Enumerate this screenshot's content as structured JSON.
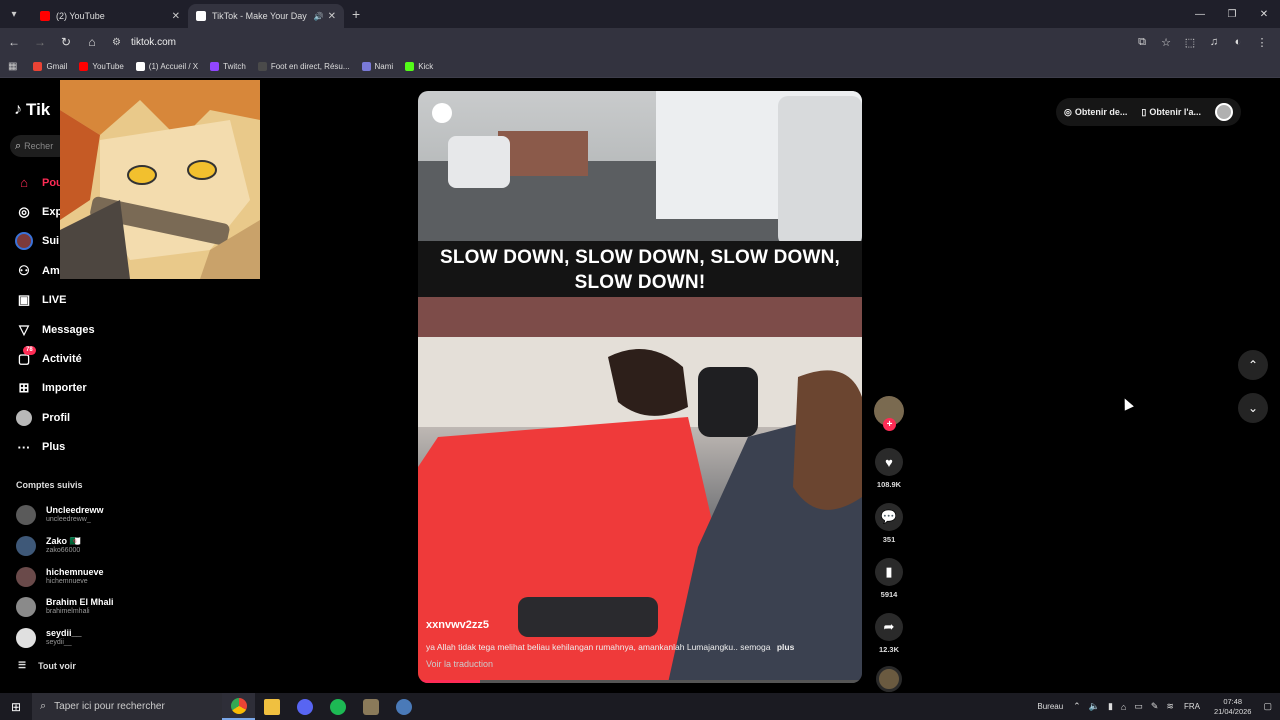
{
  "browser": {
    "tabs": [
      {
        "title": "(2) YouTube",
        "favicon_color": "#ff0000",
        "active": false
      },
      {
        "title": "TikTok - Make Your Day",
        "favicon_color": "#ffffff",
        "active": true
      }
    ],
    "new_tab_icon": "+",
    "window_controls": {
      "minimize": "—",
      "restore": "❐",
      "close": "✕"
    },
    "url": "tiktok.com",
    "bookmarks": [
      {
        "label": "Gmail",
        "color": "#ea4335"
      },
      {
        "label": "YouTube",
        "color": "#ff0000"
      },
      {
        "label": "(1) Accueil / X",
        "color": "#ffffff"
      },
      {
        "label": "Twitch",
        "color": "#9146ff"
      },
      {
        "label": "Foot en direct, Résu...",
        "color": "#4a4a4a"
      },
      {
        "label": "Nami",
        "color": "#7a7ad8"
      },
      {
        "label": "Kick",
        "color": "#53fc18"
      }
    ]
  },
  "tiktok": {
    "logo_text": "Tik",
    "search_placeholder": "Recher",
    "nav": [
      {
        "label": "Pour",
        "icon": "home-icon",
        "glyph": "⌂",
        "active": true
      },
      {
        "label": "Exp",
        "icon": "compass-icon",
        "glyph": "◎",
        "active": false
      },
      {
        "label": "Sui",
        "icon": "following-avatar-icon",
        "glyph": "",
        "active": false
      },
      {
        "label": "Am",
        "icon": "friends-icon",
        "glyph": "👥",
        "active": false
      },
      {
        "label": "LIVE",
        "icon": "live-icon",
        "glyph": "▣",
        "active": false
      },
      {
        "label": "Messages",
        "icon": "messages-icon",
        "glyph": "▽",
        "active": false
      },
      {
        "label": "Activité",
        "icon": "activity-icon",
        "glyph": "▢",
        "active": false,
        "badge": "78"
      },
      {
        "label": "Importer",
        "icon": "upload-icon",
        "glyph": "⊞",
        "active": false
      },
      {
        "label": "Profil",
        "icon": "profile-icon",
        "glyph": "●",
        "active": false
      },
      {
        "label": "Plus",
        "icon": "more-icon",
        "glyph": "···",
        "active": false
      }
    ],
    "followed_title": "Comptes suivis",
    "followed": [
      {
        "name": "Uncleedreww",
        "handle": "uncleedreww_",
        "color": "#5a5a5a"
      },
      {
        "name": "Zako 🇩🇿",
        "handle": "zako66000",
        "color": "#3e5878"
      },
      {
        "name": "hichemnueve",
        "handle": "hichemnueve",
        "color": "#6a4a4a"
      },
      {
        "name": "Brahim El Mhali",
        "handle": "brahimelmhali",
        "color": "#8a8a8a"
      },
      {
        "name": "seydii__",
        "handle": "seydii__",
        "color": "#e0e0e0"
      }
    ],
    "see_all": "Tout voir",
    "video": {
      "caption": "SLOW DOWN, SLOW DOWN, SLOW DOWN, SLOW DOWN!",
      "username": "xxnvwv2zz5",
      "description": "ya Allah tidak tega melihat beliau kehilangan rumahnya, amankanlah Lumajangku.. semoga",
      "more_label": "plus",
      "translate": "Voir la traduction",
      "progress": 0.14
    },
    "actions": {
      "likes": "108.9K",
      "comments": "351",
      "saves": "5914",
      "shares": "12.3K"
    },
    "top_right": {
      "btn1": "Obtenir de...",
      "btn2": "Obtenir l'a..."
    }
  },
  "taskbar": {
    "search_placeholder": "Taper ici pour rechercher",
    "apps": [
      {
        "name": "chrome",
        "color": "#e8b43a",
        "active": true
      },
      {
        "name": "explorer",
        "color": "#f0c040",
        "active": false
      },
      {
        "name": "discord",
        "color": "#5865f2",
        "active": false
      },
      {
        "name": "spotify",
        "color": "#1db954",
        "active": false
      },
      {
        "name": "game",
        "color": "#8a7a5a",
        "active": false
      },
      {
        "name": "steam",
        "color": "#4a7ab8",
        "active": false
      }
    ],
    "tray_label": "Bureau",
    "language": "FRA",
    "time": "07:48",
    "date": "21/04/2026"
  }
}
